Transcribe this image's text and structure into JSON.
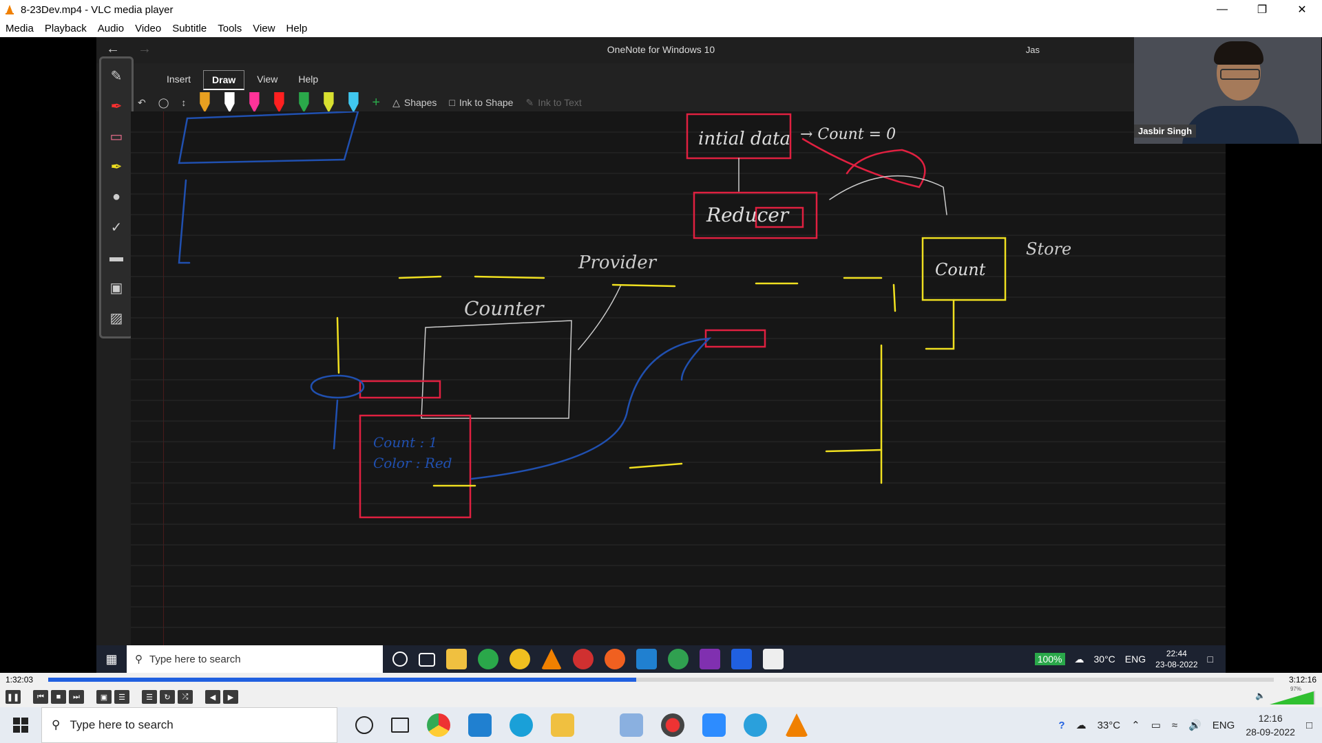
{
  "vlc": {
    "title": "8-23Dev.mp4 - VLC media player",
    "menu": [
      "Media",
      "Playback",
      "Audio",
      "Video",
      "Subtitle",
      "Tools",
      "View",
      "Help"
    ],
    "elapsed": "1:32:03",
    "total": "3:12:16",
    "progress": 0.48,
    "volume": "97%"
  },
  "onenote": {
    "title": "OneNote for Windows 10",
    "user_partial": "Jas",
    "tabs": [
      "Insert",
      "Draw",
      "View",
      "Help"
    ],
    "active_tab": "Draw",
    "shapes_label": "Shapes",
    "ink_to_shape_label": "Ink to Shape",
    "ink_to_text_label": "Ink to Text",
    "pen_colors": [
      "#e8a020",
      "#ffffff",
      "#ff3399",
      "#ff2020",
      "#2aa84a",
      "#d8e030",
      "#40c8f0"
    ]
  },
  "canvas": {
    "words": [
      "intial data",
      "→ Count = 0",
      "Reducer",
      "Provider",
      "Count",
      "Store",
      "Counter",
      "Count : 1",
      "Color : Red"
    ]
  },
  "webcam": {
    "name": "Jasbir Singh"
  },
  "inner_taskbar": {
    "search_placeholder": "Type here to search",
    "battery": "100%",
    "temp": "30°C",
    "lang": "ENG",
    "time": "22:44",
    "date": "23-08-2022"
  },
  "taskbar": {
    "search_placeholder": "Type here to search",
    "temp": "33°C",
    "lang": "ENG",
    "time": "12:16",
    "date": "28-09-2022"
  }
}
